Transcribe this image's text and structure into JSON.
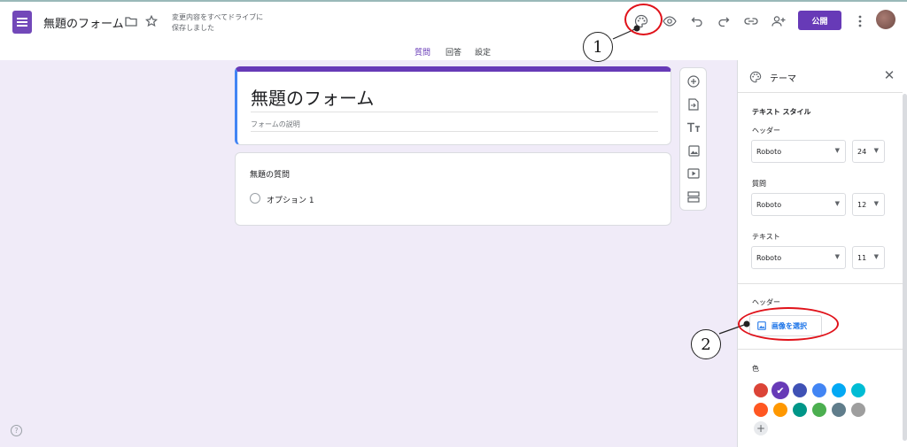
{
  "header": {
    "form_name": "無題のフォーム",
    "autosave_line1": "変更内容をすべてドライブに",
    "autosave_line2": "保存しました",
    "publish_label": "公開"
  },
  "tabs": [
    {
      "label": "質問"
    },
    {
      "label": "回答"
    },
    {
      "label": "設定"
    }
  ],
  "form": {
    "title": "無題のフォーム",
    "description_placeholder": "フォームの説明",
    "question_title": "無題の質問",
    "option_label": "オプション 1"
  },
  "theme_panel": {
    "title": "テーマ",
    "text_style_heading": "テキスト スタイル",
    "header_label": "ヘッダー",
    "header_font": "Roboto",
    "header_size": "24",
    "question_label": "質問",
    "question_font": "Roboto",
    "question_size": "12",
    "text_label": "テキスト",
    "text_font": "Roboto",
    "text_size": "11",
    "header_image_heading": "ヘッダー",
    "select_image_label": "画像を選択",
    "color_heading": "色",
    "colors": [
      "#db4437",
      "#673ab7",
      "#3f51b5",
      "#4285f4",
      "#03a9f4",
      "#00bcd4",
      "#ff5722",
      "#ff9800",
      "#009688",
      "#4caf50",
      "#607d8b",
      "#9e9e9e"
    ],
    "selected_color": "#673ab7"
  },
  "annotations": {
    "callout_1": "1",
    "callout_2": "2"
  },
  "accent_colors": {
    "primary": "#673ab7",
    "highlight_ring": "#e0121a"
  }
}
